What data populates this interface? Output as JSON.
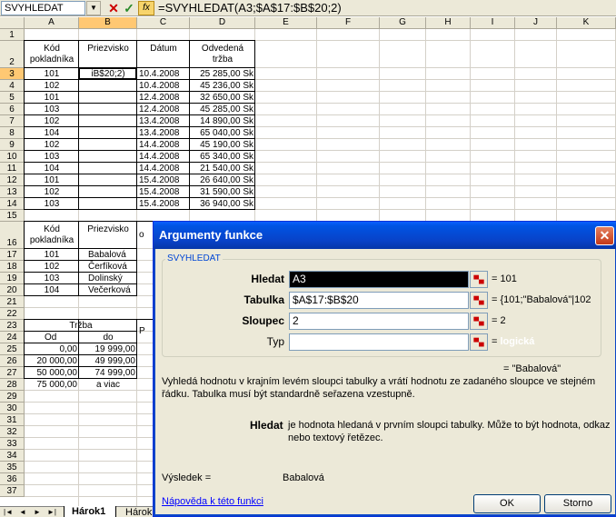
{
  "formula_bar": {
    "name_box": "SVYHLEDAT",
    "cancel": "✕",
    "enter": "✓",
    "fx": "fx",
    "formula": "=SVYHLEDAT(A3;$A$17:$B$20;2)"
  },
  "columns": [
    "A",
    "B",
    "C",
    "D",
    "E",
    "F",
    "G",
    "H",
    "I",
    "J",
    "K"
  ],
  "rows": [
    "1",
    "2",
    "3",
    "4",
    "5",
    "6",
    "7",
    "8",
    "9",
    "10",
    "11",
    "12",
    "13",
    "14",
    "15",
    "16",
    "17",
    "18",
    "19",
    "20",
    "21",
    "22",
    "23",
    "24",
    "25",
    "26",
    "27",
    "28",
    "29",
    "30",
    "31",
    "32",
    "33",
    "34",
    "35",
    "36",
    "37"
  ],
  "table1": {
    "headers": [
      "Kód pokladníka",
      "Priezvisko",
      "Dátum",
      "Odvedená tržba"
    ],
    "header_lines": [
      [
        "Kód",
        "pokladníka"
      ],
      [
        "Priezvisko"
      ],
      [
        "Dátum"
      ],
      [
        "Odvedená",
        "tržba"
      ]
    ],
    "editing_cell": "iB$20;2)",
    "rows": [
      [
        "101",
        "",
        "10.4.2008",
        "25 285,00 Sk"
      ],
      [
        "102",
        "",
        "10.4.2008",
        "45 236,00 Sk"
      ],
      [
        "101",
        "",
        "12.4.2008",
        "32 650,00 Sk"
      ],
      [
        "103",
        "",
        "12.4.2008",
        "45 285,00 Sk"
      ],
      [
        "102",
        "",
        "13.4.2008",
        "14 890,00 Sk"
      ],
      [
        "104",
        "",
        "13.4.2008",
        "65 040,00 Sk"
      ],
      [
        "102",
        "",
        "14.4.2008",
        "45 190,00 Sk"
      ],
      [
        "103",
        "",
        "14.4.2008",
        "65 340,00 Sk"
      ],
      [
        "104",
        "",
        "14.4.2008",
        "21 540,00 Sk"
      ],
      [
        "101",
        "",
        "15.4.2008",
        "26 640,00 Sk"
      ],
      [
        "102",
        "",
        "15.4.2008",
        "31 590,00 Sk"
      ],
      [
        "103",
        "",
        "15.4.2008",
        "36 940,00 Sk"
      ]
    ]
  },
  "table2": {
    "header_lines": [
      [
        "Kód",
        "pokladníka"
      ],
      [
        "Priezvisko"
      ]
    ],
    "partial_col_c_header": "o",
    "rows": [
      [
        "101",
        "Babalová"
      ],
      [
        "102",
        "Čerfíková"
      ],
      [
        "103",
        "Dolinský"
      ],
      [
        "104",
        "Večerková"
      ]
    ]
  },
  "table3": {
    "title": "Tržba",
    "partial_col_c": "P",
    "headers": [
      "Od",
      "do"
    ],
    "rows": [
      [
        "0,00",
        "19 999,00"
      ],
      [
        "20 000,00",
        "49 999,00"
      ],
      [
        "50 000,00",
        "74 999,00"
      ],
      [
        "75 000,00",
        "a viac"
      ]
    ]
  },
  "sheet_tabs": {
    "nav": [
      "|◄",
      "◄",
      "►",
      "►|"
    ],
    "tabs": [
      "Hárok1",
      "Hárok"
    ]
  },
  "dialog": {
    "title": "Argumenty funkce",
    "close": "✕",
    "function_name": "SVYHLEDAT",
    "args": [
      {
        "label": "Hledat",
        "value": "A3",
        "result": "= 101",
        "bold": true
      },
      {
        "label": "Tabulka",
        "value": "$A$17:$B$20",
        "result": "= {101;\"Babalová\"|102",
        "bold": true
      },
      {
        "label": "Sloupec",
        "value": "2",
        "result": "= 2",
        "bold": true
      },
      {
        "label": "Typ",
        "value": "",
        "result_prefix": "=",
        "result": "logická",
        "bold": false
      }
    ],
    "overall_result": "= \"Babalová\"",
    "description": "Vyhledá hodnotu v krajním levém sloupci tabulky a vrátí hodnotu ze zadaného sloupce ve stejném řádku. Tabulka musí být standardně seřazena vzestupně.",
    "arg_name": "Hledat",
    "arg_description": "je hodnota hledaná v prvním sloupci tabulky. Může to být hodnota, odkaz nebo textový řetězec.",
    "result_label": "Výsledek =",
    "result_value": "Babalová",
    "help_link": "Nápověda k této funkci",
    "ok": "OK",
    "cancel": "Storno"
  }
}
